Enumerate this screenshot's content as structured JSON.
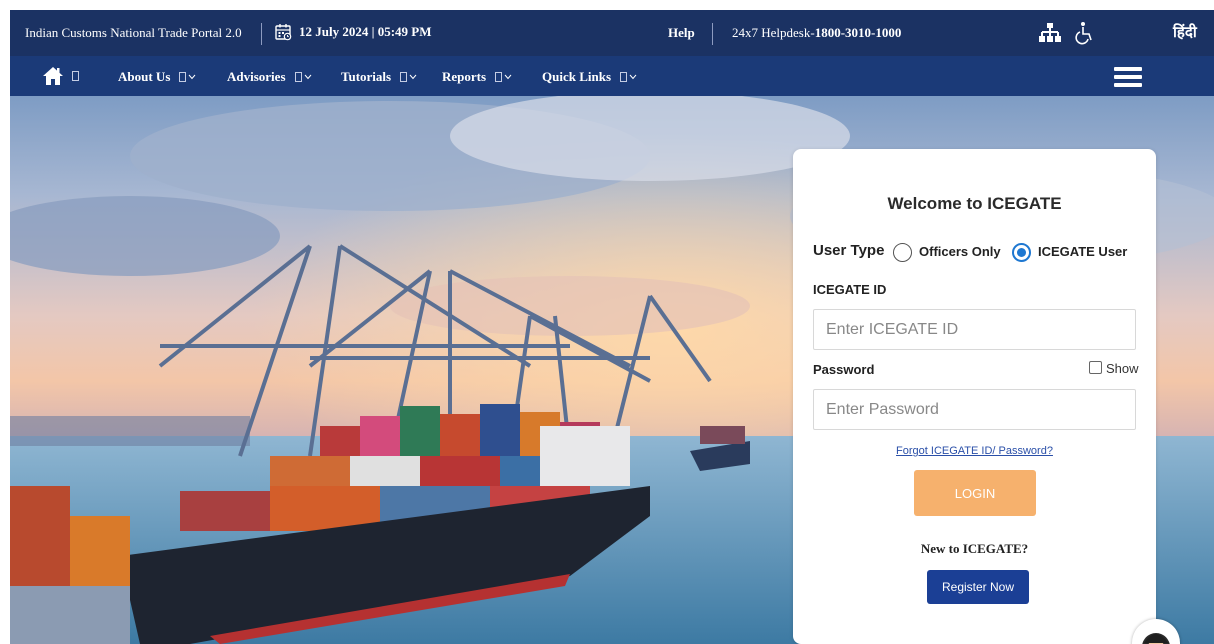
{
  "topbar": {
    "portal_title": "Indian Customs National Trade Portal 2.0",
    "datetime": "12 July 2024 | 05:49 PM",
    "help": "Help",
    "helpdesk_prefix": "24x7 Helpdesk-",
    "helpdesk_number": "1800-3010-1000",
    "hindi_label": "हिंदी",
    "icons": [
      "calendar-icon",
      "sitemap-icon",
      "accessibility-icon"
    ]
  },
  "nav": {
    "items": [
      {
        "label": "About Us"
      },
      {
        "label": "Advisories"
      },
      {
        "label": "Tutorials"
      },
      {
        "label": "Reports"
      },
      {
        "label": "Quick Links"
      }
    ],
    "icons": [
      "home-icon",
      "hamburger-menu-icon"
    ]
  },
  "login": {
    "title": "Welcome to ICEGATE",
    "user_type_label": "User Type",
    "options": [
      {
        "label": "Officers Only",
        "selected": false
      },
      {
        "label": "ICEGATE User",
        "selected": true
      }
    ],
    "id_label": "ICEGATE ID",
    "id_placeholder": "Enter ICEGATE ID",
    "password_label": "Password",
    "password_placeholder": "Enter Password",
    "show_label": "Show",
    "forgot_link": "Forgot ICEGATE ID/ Password?",
    "login_button": "LOGIN",
    "new_user_text": "New to ICEGATE?",
    "register_button": "Register Now"
  },
  "colors": {
    "topbar_bg": "#1b3263",
    "navbar_bg": "#1b3a78",
    "login_button": "#f6b16d",
    "register_button": "#1b3f95",
    "radio_selected": "#1f78d1",
    "link": "#2a4fa8"
  }
}
